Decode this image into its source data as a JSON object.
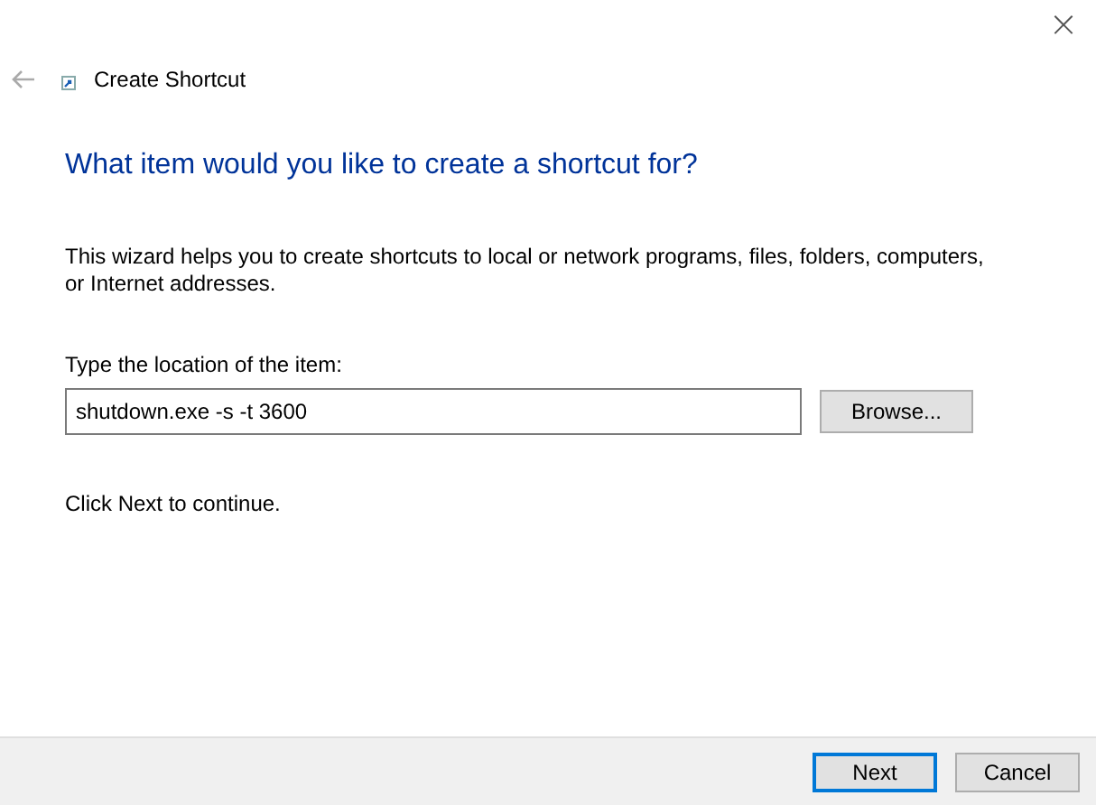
{
  "window": {
    "title": "Create Shortcut",
    "close": "×"
  },
  "heading": "What item would you like to create a shortcut for?",
  "description": "This wizard helps you to create shortcuts to local or network programs, files, folders, computers, or Internet addresses.",
  "location": {
    "label": "Type the location of the item:",
    "value": "shutdown.exe -s -t 3600"
  },
  "browse_button": "Browse...",
  "hint": "Click Next to continue.",
  "buttons": [
    {
      "label": "Next",
      "default": true
    },
    {
      "label": "Cancel",
      "default": false
    }
  ]
}
